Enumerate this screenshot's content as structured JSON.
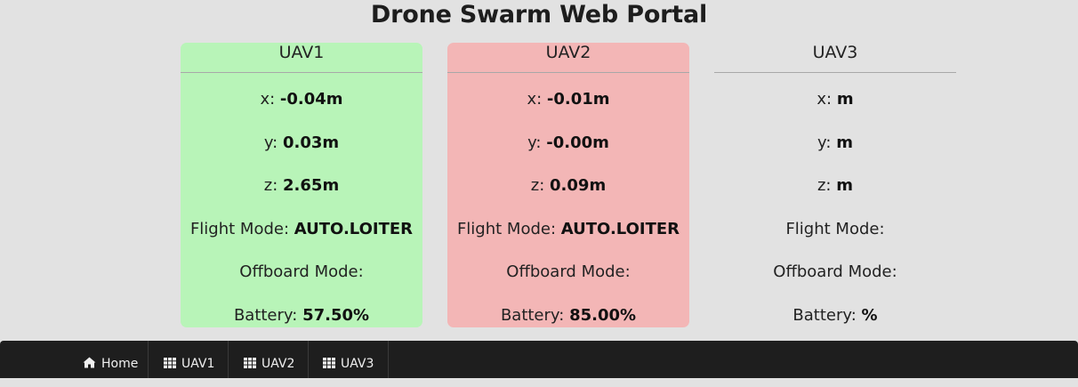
{
  "page": {
    "title": "Drone Swarm Web Portal"
  },
  "cards": [
    {
      "name": "UAV1",
      "status_color": "#b8f4b8",
      "x_label": "x:",
      "x_value": "-0.04m",
      "y_label": "y:",
      "y_value": "0.03m",
      "z_label": "z:",
      "z_value": "2.65m",
      "flight_label": "Flight Mode:",
      "flight_value": "AUTO.LOITER",
      "offboard_label": "Offboard Mode:",
      "offboard_value": "",
      "battery_label": "Battery:",
      "battery_value": "57.50%"
    },
    {
      "name": "UAV2",
      "status_color": "#f3b6b6",
      "x_label": "x:",
      "x_value": "-0.01m",
      "y_label": "y:",
      "y_value": "-0.00m",
      "z_label": "z:",
      "z_value": "0.09m",
      "flight_label": "Flight Mode:",
      "flight_value": "AUTO.LOITER",
      "offboard_label": "Offboard Mode:",
      "offboard_value": "",
      "battery_label": "Battery:",
      "battery_value": "85.00%"
    },
    {
      "name": "UAV3",
      "status_color": "#e2e2e2",
      "x_label": "x:",
      "x_value": "m",
      "y_label": "y:",
      "y_value": "m",
      "z_label": "z:",
      "z_value": "m",
      "flight_label": "Flight Mode:",
      "flight_value": "",
      "offboard_label": "Offboard Mode:",
      "offboard_value": "",
      "battery_label": "Battery:",
      "battery_value": "%"
    }
  ],
  "nav": {
    "items": [
      {
        "label": "Home",
        "icon": "home-icon"
      },
      {
        "label": "UAV1",
        "icon": "grid-icon"
      },
      {
        "label": "UAV2",
        "icon": "grid-icon"
      },
      {
        "label": "UAV3",
        "icon": "grid-icon"
      }
    ]
  }
}
